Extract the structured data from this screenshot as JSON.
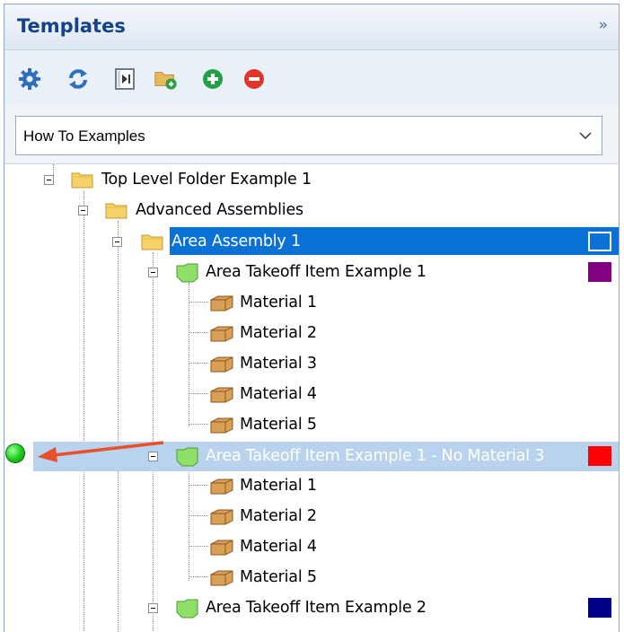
{
  "panel": {
    "title": "Templates",
    "collapse_icon": "double-chevron-right"
  },
  "toolbar": {
    "buttons": [
      {
        "name": "settings",
        "icon": "gear-icon"
      },
      {
        "name": "refresh",
        "icon": "refresh-icon"
      },
      {
        "name": "step",
        "icon": "step-icon"
      },
      {
        "name": "new-folder",
        "icon": "folder-add-icon"
      },
      {
        "name": "add",
        "icon": "plus-circle-icon"
      },
      {
        "name": "remove",
        "icon": "minus-circle-icon"
      }
    ]
  },
  "library_select": {
    "value": "How To Examples"
  },
  "tree": {
    "top_folder": "Top Level Folder Example 1",
    "subfolder": "Advanced Assemblies",
    "assembly": "Area Assembly 1",
    "item1": {
      "label": "Area Takeoff Item Example 1",
      "color": "#800080",
      "materials": [
        "Material 1",
        "Material 2",
        "Material 3",
        "Material 4",
        "Material 5"
      ]
    },
    "item2": {
      "label": "Area Takeoff Item Example 1 - No Material 3",
      "color": "#ff0000",
      "materials": [
        "Material 1",
        "Material 2",
        "Material 4",
        "Material 5"
      ]
    },
    "item3": {
      "label": "Area Takeoff Item Example 2",
      "color": "#00008b"
    },
    "assembly_color": "#0a72d4"
  },
  "colors": {
    "selection": "#0a72d4",
    "highlight": "#b9d3ee",
    "annotation_arrow": "#e8502a",
    "indicator": "#16c916"
  }
}
